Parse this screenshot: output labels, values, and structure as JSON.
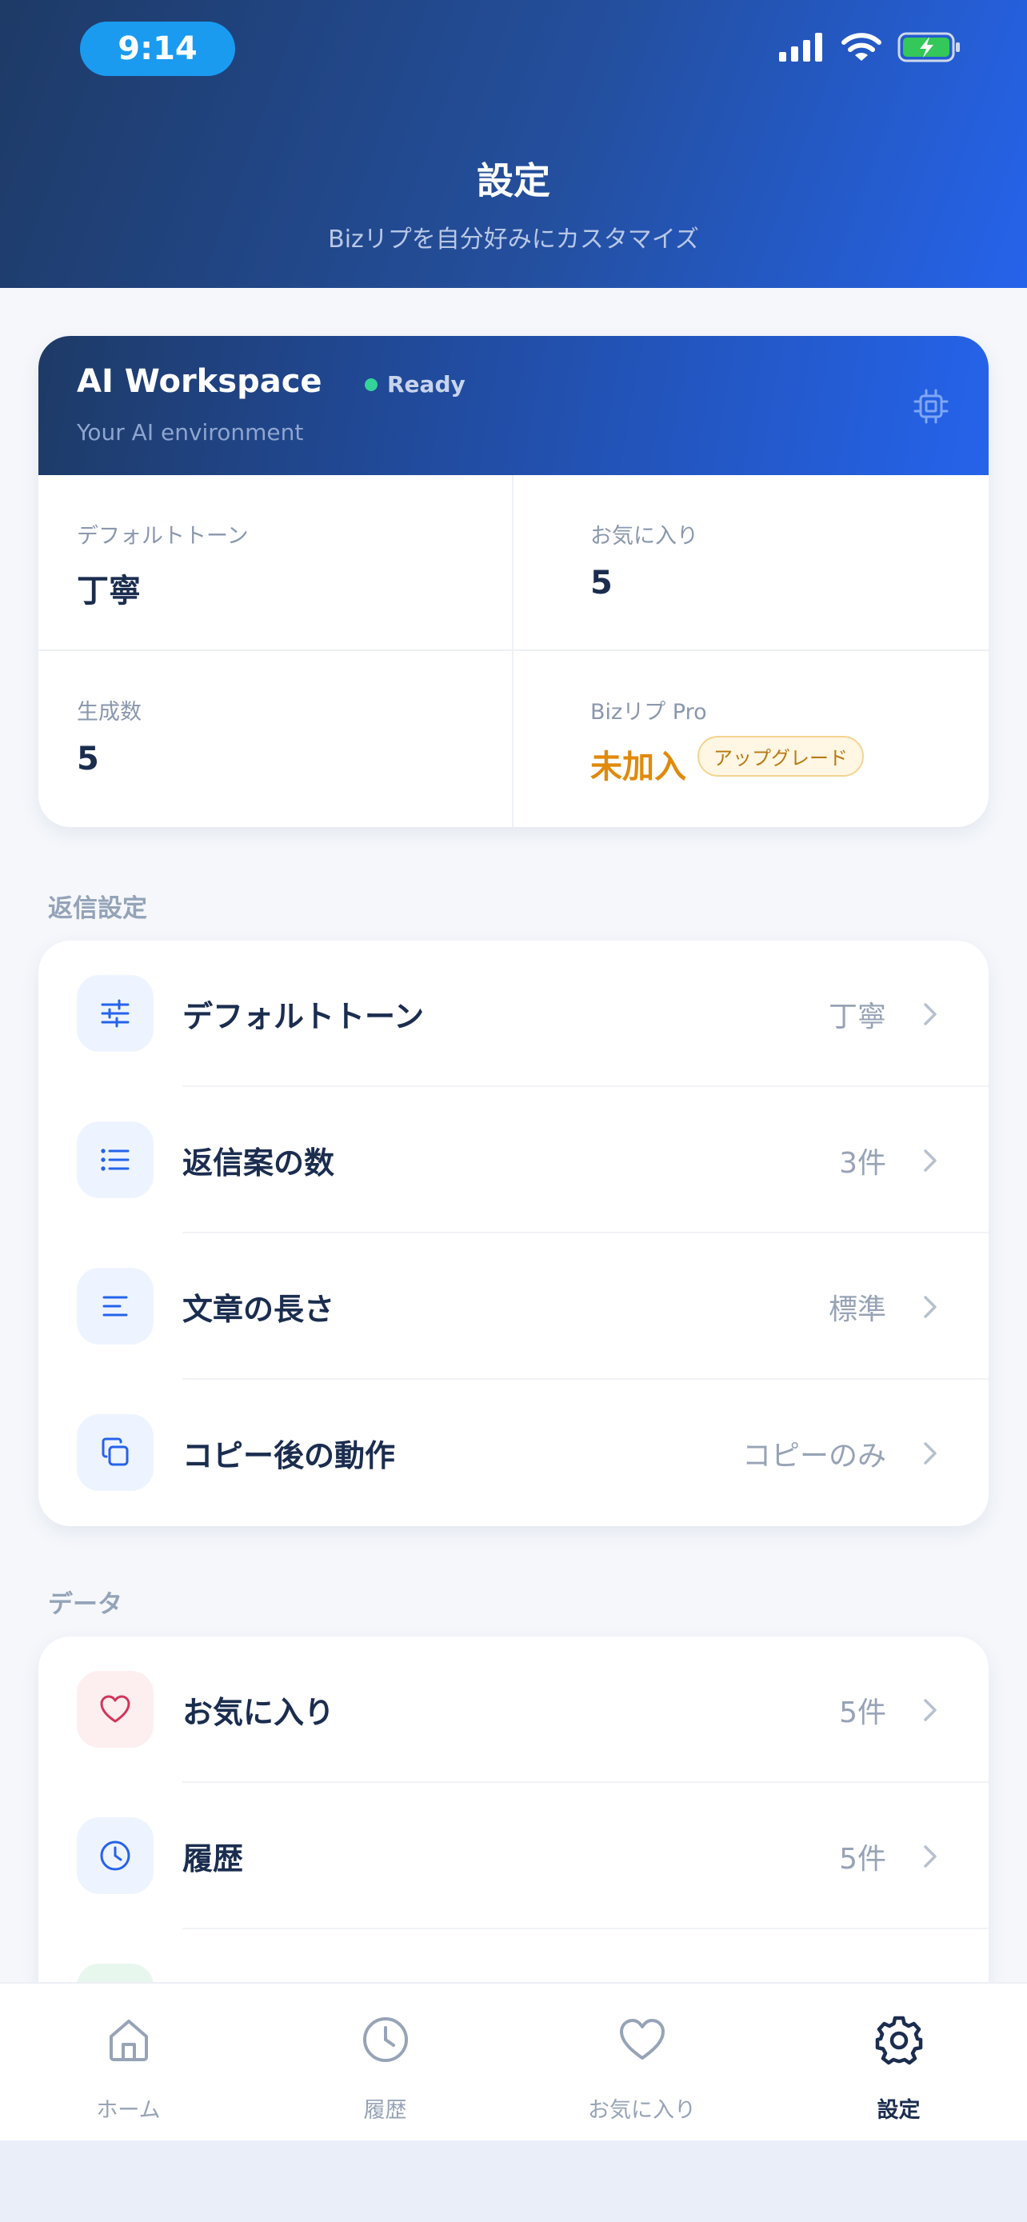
{
  "status_bar": {
    "time": "9:14"
  },
  "header": {
    "title": "設定",
    "subtitle": "Bizリプを自分好みにカスタマイズ"
  },
  "workspace": {
    "title": "AI Workspace",
    "status": "Ready",
    "subtitle": "Your AI environment",
    "stats": [
      {
        "label": "デフォルトトーン",
        "value": "丁寧"
      },
      {
        "label": "お気に入り",
        "value": "5"
      },
      {
        "label": "生成数",
        "value": "5"
      },
      {
        "label": "Bizリプ Pro",
        "value": "未加入",
        "badge": "アップグレード"
      }
    ]
  },
  "reply_settings": {
    "section_label": "返信設定",
    "items": [
      {
        "label": "デフォルトトーン",
        "value": "丁寧",
        "icon": "sliders-icon"
      },
      {
        "label": "返信案の数",
        "value": "3件",
        "icon": "list-icon"
      },
      {
        "label": "文章の長さ",
        "value": "標準",
        "icon": "text-lines-icon"
      },
      {
        "label": "コピー後の動作",
        "value": "コピーのみ",
        "icon": "copy-icon"
      }
    ]
  },
  "data_section": {
    "section_label": "データ",
    "items": [
      {
        "label": "お気に入り",
        "value": "5件",
        "icon": "heart-icon"
      },
      {
        "label": "履歴",
        "value": "5件",
        "icon": "clock-icon"
      }
    ]
  },
  "tabbar": {
    "tabs": [
      {
        "label": "ホーム",
        "icon": "home-icon",
        "active": false
      },
      {
        "label": "履歴",
        "icon": "clock-icon",
        "active": false
      },
      {
        "label": "お気に入り",
        "icon": "heart-icon",
        "active": false
      },
      {
        "label": "設定",
        "icon": "gear-icon",
        "active": true
      }
    ]
  },
  "colors": {
    "header_gradient_start": "#1e3a66",
    "header_gradient_end": "#2563eb",
    "accent_blue": "#2563eb",
    "pro_orange": "#e08a0b",
    "ready_green": "#34d399"
  }
}
